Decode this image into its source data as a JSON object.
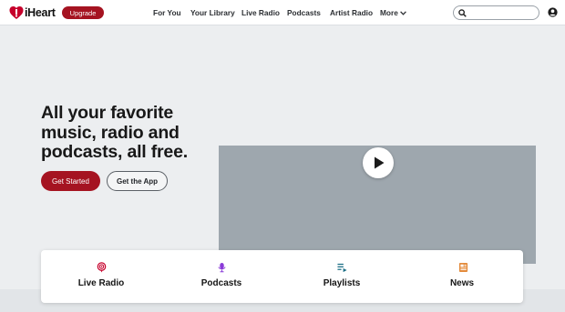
{
  "header": {
    "brand": "iHeart",
    "upgrade_label": "Upgrade",
    "nav": [
      {
        "label": "For You"
      },
      {
        "label": "Your Library"
      },
      {
        "label": "Live Radio"
      },
      {
        "label": "Podcasts"
      },
      {
        "label": "Artist Radio"
      },
      {
        "label": "More"
      }
    ],
    "more_icon": "chevron-down-icon",
    "search": {
      "value": "",
      "placeholder": "",
      "icon": "search-icon"
    },
    "account_icon": "user-icon"
  },
  "hero": {
    "headline": "All your favorite music, radio and podcasts, all free.",
    "primary_button": "Get Started",
    "secondary_button": "Get the App",
    "video_play_icon": "play-icon"
  },
  "categories": [
    {
      "label": "Live Radio",
      "icon": "live-radio-icon"
    },
    {
      "label": "Podcasts",
      "icon": "microphone-icon"
    },
    {
      "label": "Playlists",
      "icon": "playlist-icon"
    },
    {
      "label": "News",
      "icon": "news-icon"
    }
  ],
  "colors": {
    "brand_red": "#a51321",
    "live_radio_icon": "#c6002b",
    "podcasts_icon": "#8a3ad8",
    "playlists_icon": "#1d6f86",
    "news_icon": "#e38a3a"
  }
}
